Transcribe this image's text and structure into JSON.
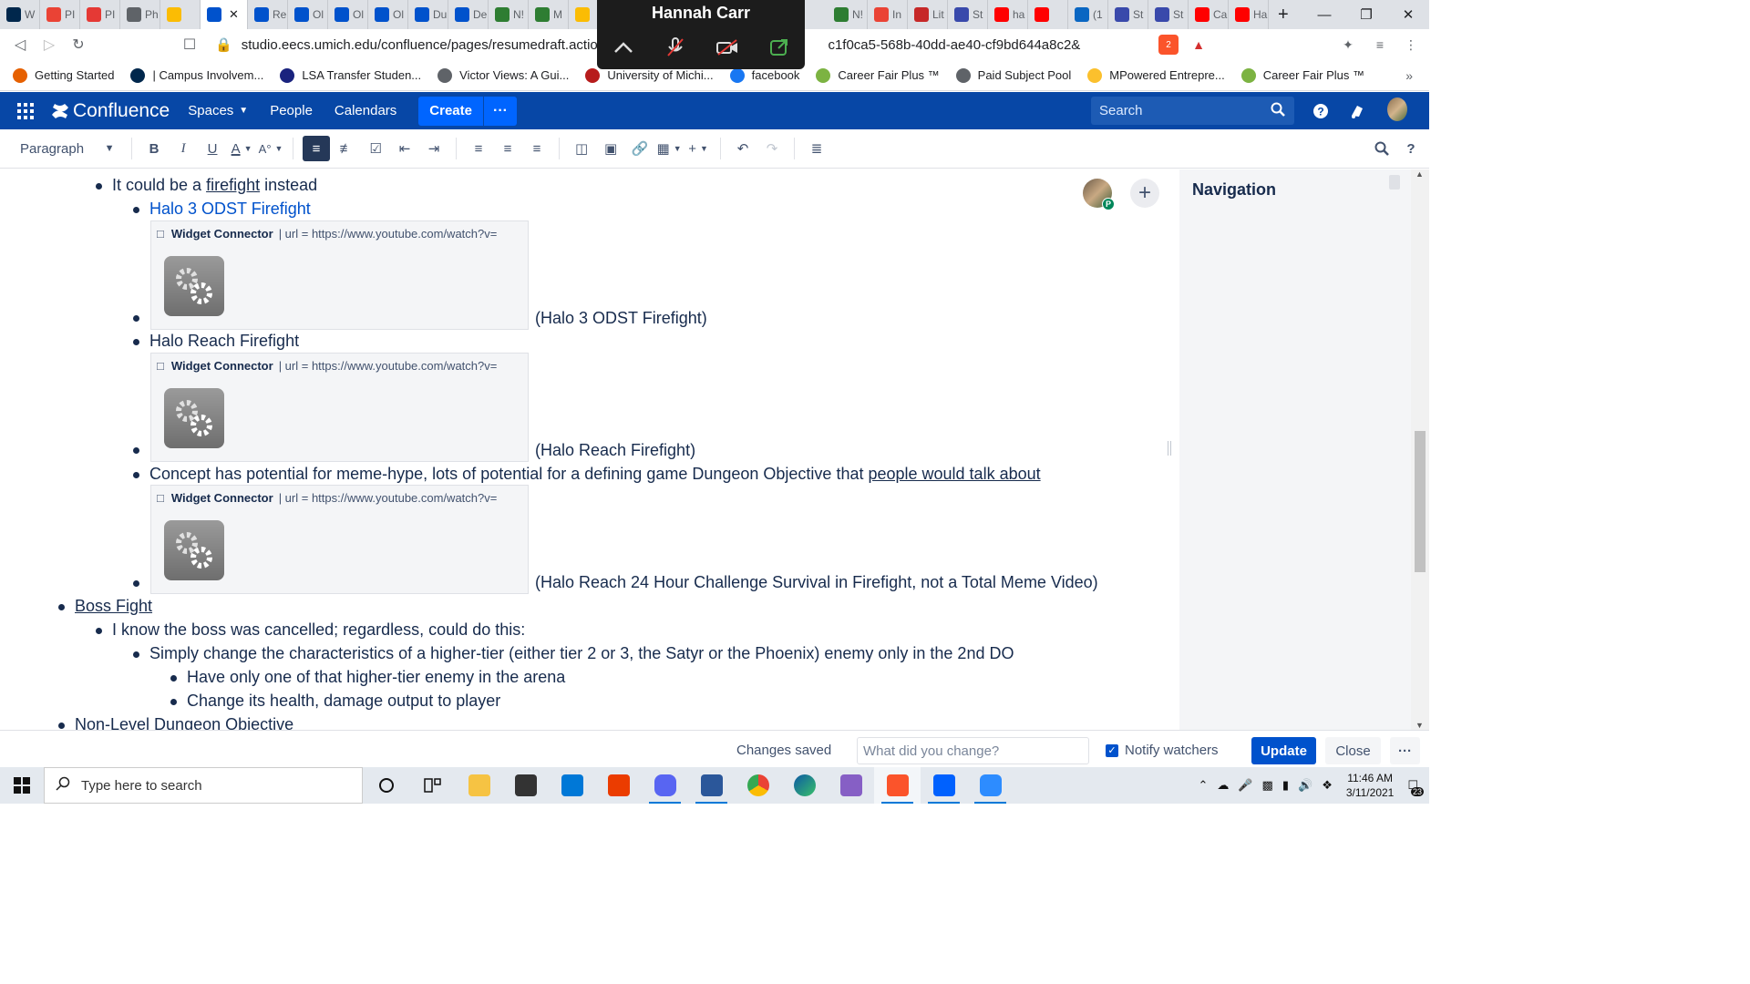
{
  "browser": {
    "tabs": [
      {
        "label": "W",
        "icon": "umich-icon",
        "color": "#00274c",
        "active": false
      },
      {
        "label": "PI",
        "icon": "gmail-icon",
        "color": "#ea4335",
        "active": false
      },
      {
        "label": "PI",
        "icon": "logo-icon",
        "color": "#e53935",
        "active": false
      },
      {
        "label": "Ph",
        "icon": "globe-icon",
        "color": "#5f6368",
        "active": false
      },
      {
        "label": "",
        "icon": "drive-icon",
        "color": "#fbbc04",
        "active": false
      },
      {
        "label": "",
        "icon": "confluence-icon",
        "color": "#0052cc",
        "active": true
      },
      {
        "label": "Re",
        "icon": "confluence-icon",
        "color": "#0052cc",
        "active": false
      },
      {
        "label": "Ol",
        "icon": "confluence-icon",
        "color": "#0052cc",
        "active": false
      },
      {
        "label": "Ol",
        "icon": "confluence-icon",
        "color": "#0052cc",
        "active": false
      },
      {
        "label": "Ol",
        "icon": "confluence-icon",
        "color": "#0052cc",
        "active": false
      },
      {
        "label": "Du",
        "icon": "confluence-icon",
        "color": "#0052cc",
        "active": false
      },
      {
        "label": "De",
        "icon": "confluence-icon",
        "color": "#0052cc",
        "active": false
      },
      {
        "label": "N!",
        "icon": "doc-icon",
        "color": "#2e7d32",
        "active": false
      },
      {
        "label": "M",
        "icon": "doc-icon",
        "color": "#2e7d32",
        "active": false
      },
      {
        "label": "",
        "icon": "drive-icon",
        "color": "#fbbc04",
        "active": false
      }
    ],
    "tabs_right": [
      {
        "label": "N!",
        "icon": "doc-icon",
        "color": "#2e7d32"
      },
      {
        "label": "In",
        "icon": "gmail-icon",
        "color": "#ea4335"
      },
      {
        "label": "Lit",
        "icon": "mw-icon",
        "color": "#c62828"
      },
      {
        "label": "St",
        "icon": "canvas-icon",
        "color": "#3949ab"
      },
      {
        "label": "ha",
        "icon": "youtube-icon",
        "color": "#ff0000"
      },
      {
        "label": "",
        "icon": "youtube-icon",
        "color": "#ff0000"
      },
      {
        "label": "(1",
        "icon": "linkedin-icon",
        "color": "#0a66c2"
      },
      {
        "label": "St",
        "icon": "canvas-icon",
        "color": "#3949ab"
      },
      {
        "label": "St",
        "icon": "canvas-icon",
        "color": "#3949ab"
      },
      {
        "label": "Ca",
        "icon": "youtube-icon",
        "color": "#ff0000"
      },
      {
        "label": "Ha",
        "icon": "youtube-icon",
        "color": "#ff0000"
      }
    ],
    "url_left": "studio.eecs.umich.edu/confluence/pages/resumedraft.action?",
    "url_right": "c1f0ca5-568b-40dd-ae40-cf9bd644a8c2&",
    "brave_badge": "2",
    "bookmarks": [
      {
        "label": "Getting Started",
        "icon": "firefox-icon",
        "color": "#e66000"
      },
      {
        "label": "| Campus Involvem...",
        "icon": "umich-icon",
        "color": "#00274c"
      },
      {
        "label": "LSA Transfer Studen...",
        "icon": "lsa-icon",
        "color": "#1a237e"
      },
      {
        "label": "Victor Views: A Gui...",
        "icon": "globe-icon",
        "color": "#5f6368"
      },
      {
        "label": "University of Michi...",
        "icon": "um-icon",
        "color": "#b71c1c"
      },
      {
        "label": "facebook",
        "icon": "facebook-icon",
        "color": "#1877f2"
      },
      {
        "label": "Career Fair Plus ™",
        "icon": "careerfair-icon",
        "color": "#7cb342"
      },
      {
        "label": "Paid Subject Pool",
        "icon": "globe-icon",
        "color": "#5f6368"
      },
      {
        "label": "MPowered Entrepre...",
        "icon": "hexagon-icon",
        "color": "#fbc02d"
      },
      {
        "label": "Career Fair Plus ™",
        "icon": "careerfair-icon",
        "color": "#7cb342"
      }
    ]
  },
  "zoom": {
    "name": "Hannah Carr"
  },
  "confluence": {
    "logo": "Confluence",
    "nav": [
      "Spaces",
      "People",
      "Calendars"
    ],
    "create": "Create",
    "search_placeholder": "Search",
    "paragraph_style": "Paragraph",
    "nav_panel_title": "Navigation"
  },
  "content": {
    "lines": [
      {
        "text": "It could be a ",
        "link": "firefight",
        "after": " instead"
      },
      {
        "text": "Halo 3 ODST Firefight"
      },
      {
        "text": "(Halo 3 ODST Firefight)"
      },
      {
        "text": "Halo Reach Firefight"
      },
      {
        "text": "(Halo Reach Firefight)"
      },
      {
        "text": "Concept has potential for meme-hype, lots of potential for a defining game Dungeon Objective that ",
        "link": "people would talk about"
      },
      {
        "text": "(Halo Reach 24 Hour Challenge Survival in Firefight, not a Total Meme Video)"
      },
      {
        "text": "Boss Fight"
      },
      {
        "text": "I know the boss was cancelled; regardless, could do this:"
      },
      {
        "text": "Simply change the characteristics of a higher-tier (either tier 2 or 3, the Satyr or the Phoenix) enemy only in the 2nd DO"
      },
      {
        "text": "Have only one of that higher-tier enemy in the arena"
      },
      {
        "text": "Change its health, damage output to player"
      },
      {
        "text": "Non-Level Dungeon Objective"
      }
    ],
    "widget": {
      "title": "Widget Connector",
      "url": "| url = https://www.youtube.com/watch?v="
    },
    "collaborator_badge": "P"
  },
  "bottom": {
    "status": "Changes saved",
    "message_placeholder": "What did you change?",
    "notify": "Notify watchers",
    "update": "Update",
    "close": "Close"
  },
  "taskbar": {
    "search_placeholder": "Type here to search",
    "time": "11:46 AM",
    "date": "3/11/2021",
    "notifications": "23"
  }
}
